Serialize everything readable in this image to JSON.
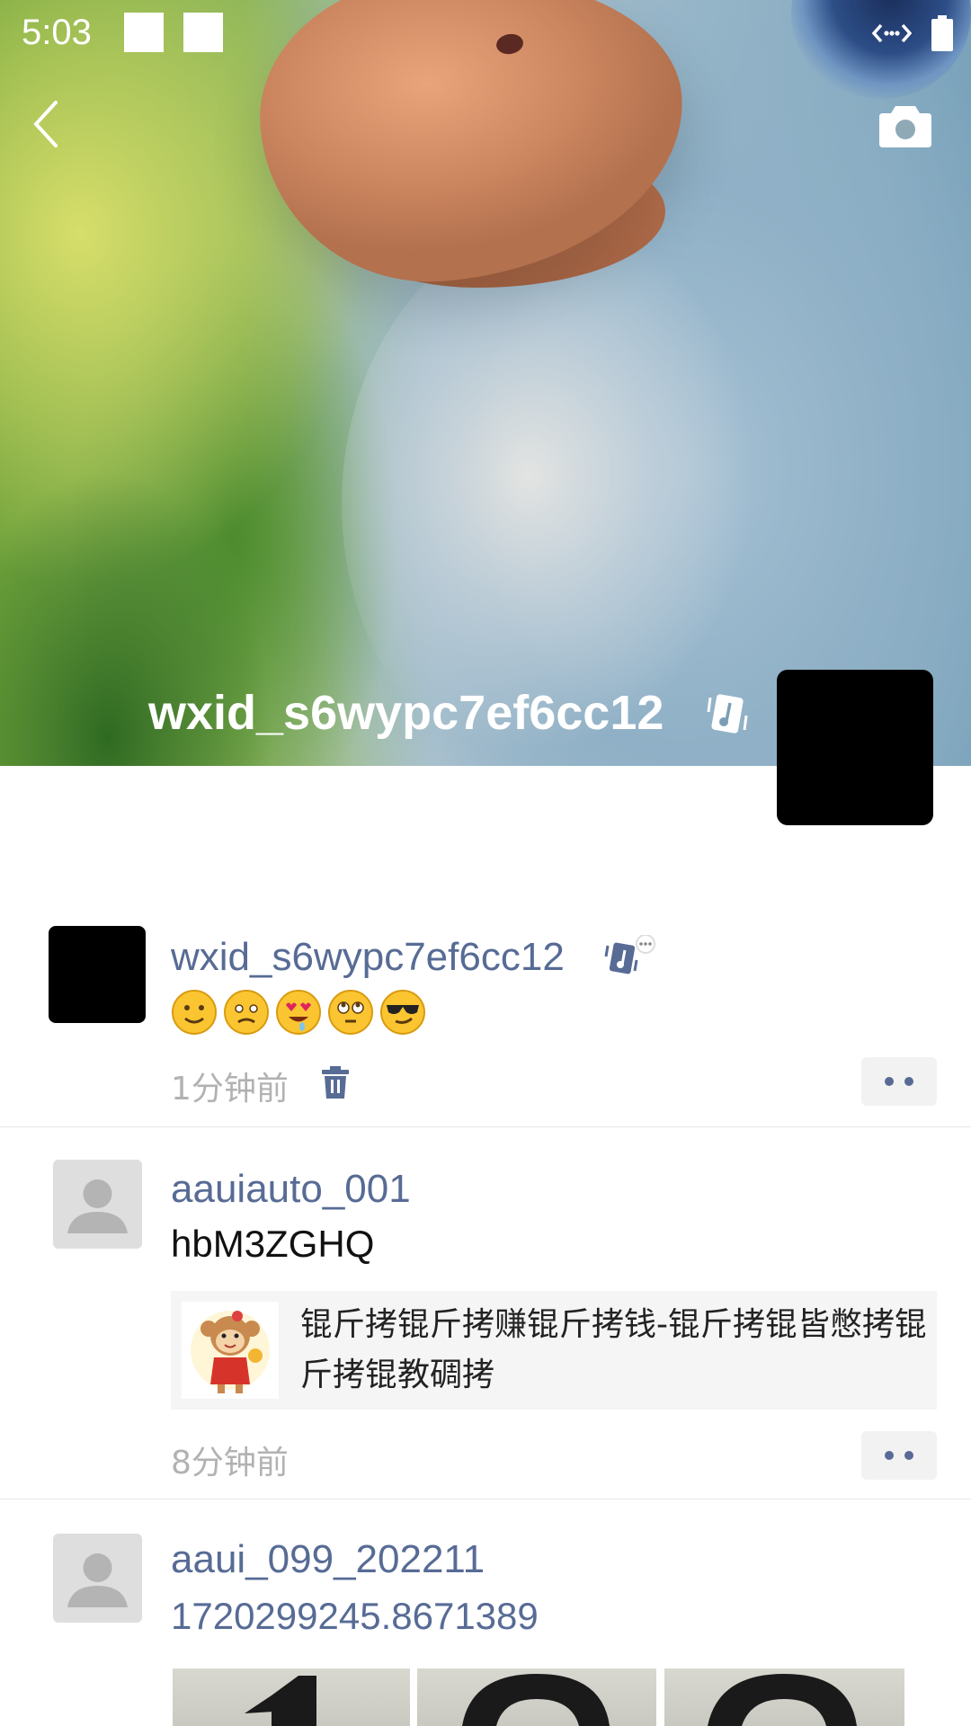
{
  "status_bar": {
    "time": "5:03"
  },
  "header": {
    "back_icon": "chevron-left-icon",
    "camera_icon": "camera-icon",
    "profile_name": "wxid_s6wypc7ef6cc12"
  },
  "posts": [
    {
      "author": "wxid_s6wypc7ef6cc12",
      "emojis": [
        "slightly-smiling",
        "worried",
        "heart-eyes-drooling",
        "rolling-eyes",
        "sunglasses"
      ],
      "time": "1分钟前",
      "delete_icon": "trash-icon"
    },
    {
      "author": "aauiauto_001",
      "text": "hbM3ZGHQ",
      "link_title": "锟斤拷锟斤拷赚锟斤拷钱-锟斤拷锟皆憋拷锟斤拷锟教碉拷",
      "time": "8分钟前"
    },
    {
      "author": "aaui_099_202211",
      "text": "1720299245.8671389"
    }
  ],
  "colors": {
    "link_blue": "#576b95",
    "time_gray": "#b2b2b2"
  }
}
